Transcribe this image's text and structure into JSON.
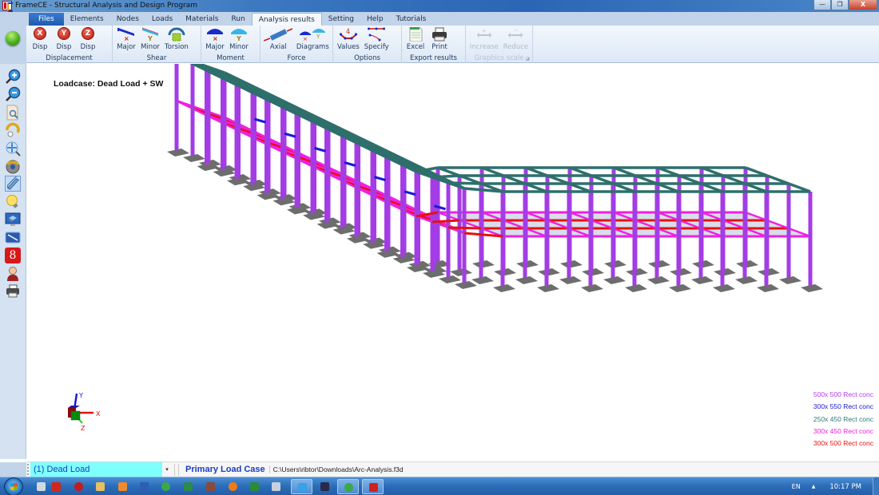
{
  "window": {
    "title": "FrameCE - Structural Analysis and Design Program",
    "controls": {
      "minimize": "—",
      "restore": "❐",
      "close": "X"
    }
  },
  "tabs": [
    {
      "label": "Files",
      "active": false
    },
    {
      "label": "Elements",
      "active": false
    },
    {
      "label": "Nodes",
      "active": false
    },
    {
      "label": "Loads",
      "active": false
    },
    {
      "label": "Materials",
      "active": false
    },
    {
      "label": "Run",
      "active": false
    },
    {
      "label": "Analysis results",
      "active": true
    },
    {
      "label": "Setting",
      "active": false
    },
    {
      "label": "Help",
      "active": false
    },
    {
      "label": "Tutorials",
      "active": false
    }
  ],
  "ribbon": {
    "groups": [
      {
        "label": "Displacement",
        "buttons": [
          {
            "label": "Disp",
            "icon": "x-disp-icon",
            "glyph": "X"
          },
          {
            "label": "Disp",
            "icon": "y-disp-icon",
            "glyph": "Y"
          },
          {
            "label": "Disp",
            "icon": "z-disp-icon",
            "glyph": "Z"
          }
        ]
      },
      {
        "label": "Shear",
        "buttons": [
          {
            "label": "Major",
            "icon": "shear-major-icon"
          },
          {
            "label": "Minor",
            "icon": "shear-minor-icon"
          },
          {
            "label": "Torsion",
            "icon": "torsion-icon"
          }
        ]
      },
      {
        "label": "Moment",
        "buttons": [
          {
            "label": "Major",
            "icon": "moment-major-icon"
          },
          {
            "label": "Minor",
            "icon": "moment-minor-icon"
          }
        ]
      },
      {
        "label": "Force",
        "buttons": [
          {
            "label": "Axial",
            "icon": "axial-force-icon"
          },
          {
            "label": "Diagrams",
            "icon": "diagrams-icon"
          }
        ]
      },
      {
        "label": "Options",
        "buttons": [
          {
            "label": "Values",
            "icon": "values-icon",
            "glyph": "4"
          },
          {
            "label": "Specify",
            "icon": "specify-icon"
          }
        ]
      },
      {
        "label": "Export results",
        "buttons": [
          {
            "label": "Excel",
            "icon": "excel-icon"
          },
          {
            "label": "Print",
            "icon": "printer-icon"
          }
        ]
      },
      {
        "label": "Graphics scale",
        "disabled": true,
        "buttons": [
          {
            "label": "Increase",
            "icon": "scale-increase-icon",
            "disabled": true
          },
          {
            "label": "Reduce",
            "icon": "scale-reduce-icon",
            "disabled": true
          }
        ]
      }
    ]
  },
  "left_toolbar": [
    {
      "icon": "zoom-in-icon"
    },
    {
      "icon": "zoom-out-icon"
    },
    {
      "icon": "zoom-window-icon"
    },
    {
      "icon": "rotate-icon"
    },
    {
      "icon": "pan-zoom-icon"
    },
    {
      "icon": "orbit-icon"
    },
    {
      "icon": "extrude-section-icon",
      "selected": true
    },
    {
      "icon": "light-bulb-icon"
    },
    {
      "icon": "render-view-icon"
    },
    {
      "icon": "wireframe-view-icon"
    },
    {
      "icon": "google-icon",
      "glyph": "8"
    },
    {
      "icon": "user-help-icon"
    },
    {
      "icon": "printer-icon"
    }
  ],
  "canvas": {
    "loadcase_title": "Loadcase: Dead Load + SW",
    "legend": [
      {
        "label": "500x 500 Rect conc",
        "color": "#b33cf0"
      },
      {
        "label": "300x 550 Rect conc",
        "color": "#1a1ad8"
      },
      {
        "label": "250x 450 Rect conc",
        "color": "#2e7b78"
      },
      {
        "label": "300x 450 Rect conc",
        "color": "#f020e0"
      },
      {
        "label": "300x 500 Rect conc",
        "color": "#ee1111"
      }
    ],
    "axes": {
      "x": "X",
      "y": "Y",
      "z": "Z"
    },
    "colors": {
      "column": "#a43ce6",
      "roof_beam": "#2e6f6c",
      "floor_beam_magenta": "#f020e0",
      "floor_beam_red": "#e81010",
      "floor_beam_blue": "#1a1ad8",
      "slab": "#b8c2da",
      "footing": "#6d6d6d"
    }
  },
  "statusbar": {
    "loadcase_selected": "(1) Dead Load",
    "load_case_type": "Primary Load Case",
    "file_path": "C:\\Users\\ribtor\\Downloads\\Arc-Analysis.f3d"
  },
  "taskbar": {
    "items": [
      {
        "icon": "apps-grid-icon",
        "color": "#d0d8e4"
      },
      {
        "icon": "acrobat-icon",
        "color": "#d3251a"
      },
      {
        "icon": "app-red-circle-icon",
        "color": "#c81a1a"
      },
      {
        "icon": "file-explorer-icon",
        "color": "#e8c060"
      },
      {
        "icon": "media-player-icon",
        "color": "#f08a2a"
      },
      {
        "icon": "word-icon",
        "color": "#2b5fb4"
      },
      {
        "icon": "chrome-icon",
        "color": "#3aa84a"
      },
      {
        "icon": "image-viewer-icon",
        "color": "#2c8a4c"
      },
      {
        "icon": "presentation-icon",
        "color": "#8a4a3a"
      },
      {
        "icon": "firefox-icon",
        "color": "#f07a1a"
      },
      {
        "icon": "excel-icon",
        "color": "#2a8a3a"
      },
      {
        "icon": "paint-icon",
        "color": "#c8d0dc"
      },
      {
        "icon": "internet-explorer-icon",
        "color": "#3aa0e8",
        "active": true
      },
      {
        "icon": "visual-studio-icon",
        "color": "#2a2a4a"
      },
      {
        "icon": "chrome-icon",
        "color": "#3aa84a",
        "active": true
      },
      {
        "icon": "framece-icon",
        "color": "#d02020",
        "active": true
      }
    ],
    "language": "EN",
    "time": "10:17 PM"
  }
}
